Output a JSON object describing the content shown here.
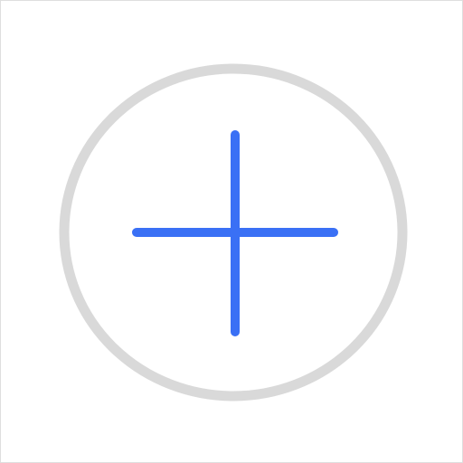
{
  "icon": {
    "name": "plus-icon",
    "ring_color": "#d9d9d9",
    "plus_color": "#3a70f5"
  }
}
